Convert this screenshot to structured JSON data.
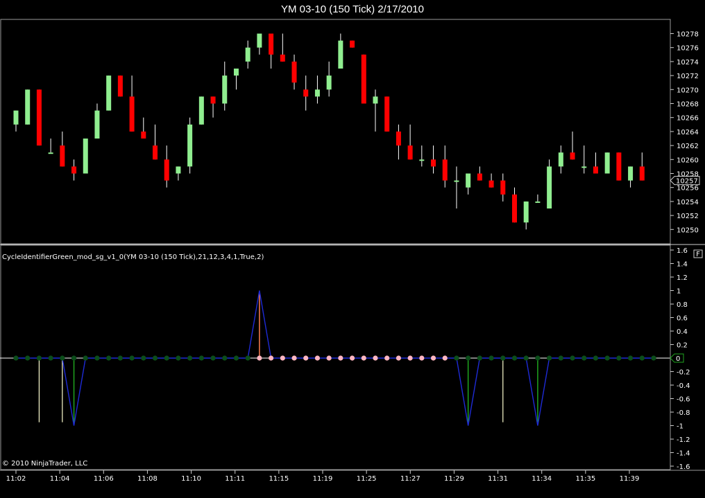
{
  "window": {
    "title": "YM 03-10 (150 Tick)  2/17/2010",
    "copyright": "© 2010 NinjaTrader, LLC",
    "f_button": "F"
  },
  "colors": {
    "up": "#90EE90",
    "down": "#FF0000",
    "wick": "#FFFFFF",
    "dot_neutral": "#0B4D1A",
    "dot_pink": "#FFB6C1",
    "blue_line": "#1E2BD6",
    "green_line": "#1FA61F",
    "peak_line": "#FF7F50",
    "yellow_line": "#FFFFD0"
  },
  "chart_data": [
    {
      "type": "candlestick",
      "title": "YM 03-10 (150 Tick)  2/17/2010",
      "ylim": [
        10248,
        10280
      ],
      "yticks": [
        10250,
        10252,
        10254,
        10256,
        10258,
        10260,
        10262,
        10264,
        10266,
        10268,
        10270,
        10272,
        10274,
        10276,
        10278
      ],
      "last_price": "10257",
      "candles": [
        {
          "o": 10265,
          "h": 10267,
          "l": 10264,
          "c": 10267
        },
        {
          "o": 10265,
          "h": 10270,
          "l": 10265,
          "c": 10270
        },
        {
          "o": 10270,
          "h": 10270,
          "l": 10262,
          "c": 10262
        },
        {
          "o": 10261,
          "h": 10263,
          "l": 10261,
          "c": 10261
        },
        {
          "o": 10262,
          "h": 10264,
          "l": 10259,
          "c": 10259
        },
        {
          "o": 10259,
          "h": 10260,
          "l": 10257,
          "c": 10258
        },
        {
          "o": 10258,
          "h": 10263,
          "l": 10258,
          "c": 10263
        },
        {
          "o": 10263,
          "h": 10268,
          "l": 10263,
          "c": 10267
        },
        {
          "o": 10267,
          "h": 10272,
          "l": 10267,
          "c": 10272
        },
        {
          "o": 10272,
          "h": 10272,
          "l": 10269,
          "c": 10269
        },
        {
          "o": 10269,
          "h": 10272,
          "l": 10264,
          "c": 10264
        },
        {
          "o": 10264,
          "h": 10266,
          "l": 10263,
          "c": 10263
        },
        {
          "o": 10262,
          "h": 10265,
          "l": 10260,
          "c": 10260
        },
        {
          "o": 10260,
          "h": 10262,
          "l": 10256,
          "c": 10257
        },
        {
          "o": 10258,
          "h": 10259,
          "l": 10257,
          "c": 10259
        },
        {
          "o": 10259,
          "h": 10266,
          "l": 10258,
          "c": 10265
        },
        {
          "o": 10265,
          "h": 10269,
          "l": 10265,
          "c": 10269
        },
        {
          "o": 10269,
          "h": 10269,
          "l": 10266,
          "c": 10268
        },
        {
          "o": 10268,
          "h": 10274,
          "l": 10267,
          "c": 10272
        },
        {
          "o": 10272,
          "h": 10273,
          "l": 10270,
          "c": 10273
        },
        {
          "o": 10274,
          "h": 10277,
          "l": 10273,
          "c": 10276
        },
        {
          "o": 10276,
          "h": 10278,
          "l": 10275,
          "c": 10278
        },
        {
          "o": 10278,
          "h": 10278,
          "l": 10273,
          "c": 10275
        },
        {
          "o": 10275,
          "h": 10278,
          "l": 10274,
          "c": 10274
        },
        {
          "o": 10274,
          "h": 10275,
          "l": 10270,
          "c": 10271
        },
        {
          "o": 10270,
          "h": 10272,
          "l": 10267,
          "c": 10269
        },
        {
          "o": 10269,
          "h": 10272,
          "l": 10268,
          "c": 10270
        },
        {
          "o": 10270,
          "h": 10274,
          "l": 10269,
          "c": 10272
        },
        {
          "o": 10273,
          "h": 10278,
          "l": 10273,
          "c": 10277
        },
        {
          "o": 10277,
          "h": 10277,
          "l": 10276,
          "c": 10276
        },
        {
          "o": 10275,
          "h": 10275,
          "l": 10268,
          "c": 10268
        },
        {
          "o": 10268,
          "h": 10270,
          "l": 10264,
          "c": 10269
        },
        {
          "o": 10269,
          "h": 10269,
          "l": 10264,
          "c": 10264
        },
        {
          "o": 10264,
          "h": 10265,
          "l": 10260,
          "c": 10262
        },
        {
          "o": 10262,
          "h": 10265,
          "l": 10260,
          "c": 10260
        },
        {
          "o": 10260,
          "h": 10262,
          "l": 10259,
          "c": 10260
        },
        {
          "o": 10260,
          "h": 10262,
          "l": 10258,
          "c": 10259
        },
        {
          "o": 10260,
          "h": 10262,
          "l": 10256,
          "c": 10257
        },
        {
          "o": 10257,
          "h": 10259,
          "l": 10253,
          "c": 10257
        },
        {
          "o": 10256,
          "h": 10258,
          "l": 10255,
          "c": 10258
        },
        {
          "o": 10258,
          "h": 10259,
          "l": 10257,
          "c": 10257
        },
        {
          "o": 10257,
          "h": 10258,
          "l": 10256,
          "c": 10256
        },
        {
          "o": 10257,
          "h": 10258,
          "l": 10254,
          "c": 10255
        },
        {
          "o": 10255,
          "h": 10256,
          "l": 10251,
          "c": 10251
        },
        {
          "o": 10251,
          "h": 10254,
          "l": 10250,
          "c": 10254
        },
        {
          "o": 10254,
          "h": 10255,
          "l": 10254,
          "c": 10254
        },
        {
          "o": 10253,
          "h": 10260,
          "l": 10253,
          "c": 10259
        },
        {
          "o": 10259,
          "h": 10262,
          "l": 10258,
          "c": 10261
        },
        {
          "o": 10261,
          "h": 10264,
          "l": 10260,
          "c": 10260
        },
        {
          "o": 10259,
          "h": 10262,
          "l": 10258,
          "c": 10259
        },
        {
          "o": 10259,
          "h": 10261,
          "l": 10258,
          "c": 10258
        },
        {
          "o": 10258,
          "h": 10261,
          "l": 10258,
          "c": 10261
        },
        {
          "o": 10261,
          "h": 10261,
          "l": 10257,
          "c": 10257
        },
        {
          "o": 10257,
          "h": 10259,
          "l": 10256,
          "c": 10259
        },
        {
          "o": 10259,
          "h": 10261,
          "l": 10257,
          "c": 10257
        }
      ]
    },
    {
      "type": "line",
      "title": "CycleIdentifierGreen_mod_sg_v1_0(YM 03-10 (150 Tick),21,12,3,4,1,True,2)",
      "ylim": [
        -1.6,
        1.6
      ],
      "yticks": [
        1.6,
        1.4,
        1.2,
        1,
        0.8,
        0.6,
        0.4,
        0.2,
        0,
        -0.2,
        -0.4,
        -0.6,
        -0.8,
        -1,
        -1.2,
        -1.4,
        -1.6
      ],
      "last_value": "0",
      "blue_series": [
        0,
        0,
        0,
        0,
        0,
        -1,
        0,
        0,
        0,
        0,
        0,
        0,
        0,
        0,
        0,
        0,
        0,
        0,
        0,
        0,
        0,
        1,
        0,
        0,
        0,
        0,
        0,
        0,
        0,
        0,
        0,
        0,
        0,
        0,
        0,
        0,
        0,
        0,
        0,
        -1,
        0,
        0,
        0,
        0,
        0,
        -1,
        0,
        0,
        0,
        0,
        0,
        0,
        0,
        0,
        0,
        0
      ],
      "dot_colors": [
        "n",
        "n",
        "n",
        "n",
        "n",
        "n",
        "n",
        "n",
        "n",
        "n",
        "n",
        "n",
        "n",
        "n",
        "n",
        "n",
        "n",
        "n",
        "n",
        "n",
        "n",
        "p",
        "p",
        "p",
        "p",
        "p",
        "p",
        "p",
        "p",
        "p",
        "p",
        "p",
        "p",
        "p",
        "p",
        "p",
        "p",
        "p",
        "n",
        "n",
        "n",
        "n",
        "n",
        "n",
        "n",
        "n",
        "n",
        "n",
        "n",
        "n",
        "n",
        "n",
        "n",
        "n",
        "n",
        "n"
      ],
      "yellow_bars": [
        {
          "i": 2,
          "v": -0.95
        },
        {
          "i": 4,
          "v": -0.95
        },
        {
          "i": 42,
          "v": -0.95
        }
      ],
      "green_bars": [
        {
          "i": 5,
          "v": -0.95
        },
        {
          "i": 39,
          "v": -0.95
        },
        {
          "i": 45,
          "v": -0.95
        }
      ],
      "peak_bars": [
        {
          "i": 21,
          "v": 0.95
        }
      ]
    }
  ],
  "time_axis": [
    "11:02",
    "11:04",
    "11:06",
    "11:08",
    "11:10",
    "11:11",
    "11:15",
    "11:19",
    "11:25",
    "11:27",
    "11:29",
    "11:31",
    "11:34",
    "11:35",
    "11:39"
  ]
}
